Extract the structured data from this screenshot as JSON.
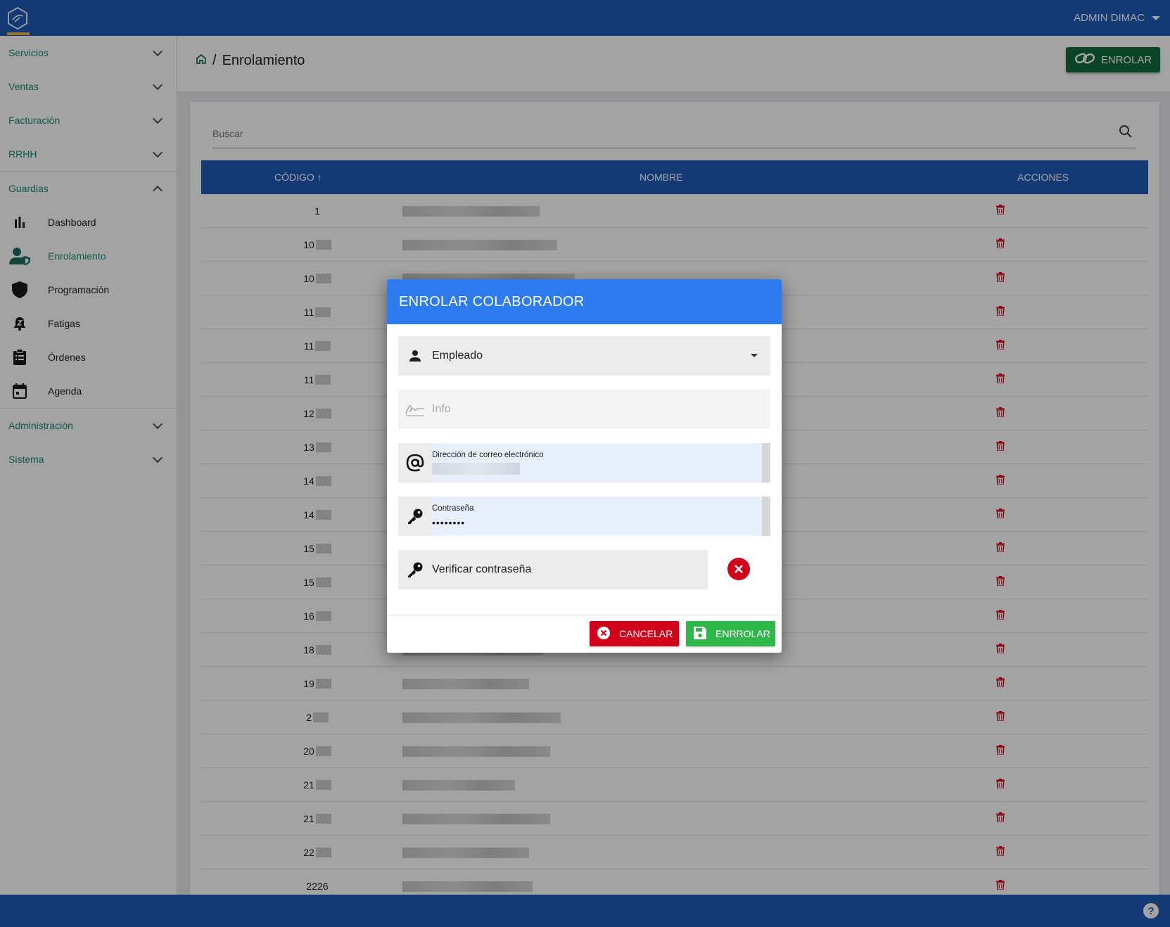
{
  "topbar": {
    "user_name": "ADMIN DIMAC"
  },
  "sidebar": {
    "sections": [
      {
        "label": "Servicios"
      },
      {
        "label": "Ventas"
      },
      {
        "label": "Facturación"
      },
      {
        "label": "RRHH"
      },
      {
        "label": "Guardias"
      }
    ],
    "guardias_items": [
      {
        "label": "Dashboard",
        "icon": "bar-chart-icon"
      },
      {
        "label": "Enrolamiento",
        "icon": "user-shield-icon"
      },
      {
        "label": "Programación",
        "icon": "shield-icon"
      },
      {
        "label": "Fatigas",
        "icon": "bell-z-icon"
      },
      {
        "label": "Órdenes",
        "icon": "clipboard-icon"
      },
      {
        "label": "Agenda",
        "icon": "calendar-icon"
      }
    ],
    "bottom_sections": [
      {
        "label": "Administración"
      },
      {
        "label": "Sistema"
      }
    ]
  },
  "header": {
    "breadcrumb_sep": "/",
    "title": "Enrolamiento",
    "enrolar_button": "ENROLAR"
  },
  "search": {
    "placeholder": "Buscar"
  },
  "table": {
    "columns": [
      "CÓDIGO",
      "NOMBRE",
      "ACCIONES"
    ],
    "sort_indicator": "↑",
    "rows": [
      {
        "code": "1"
      },
      {
        "code": "10"
      },
      {
        "code": "10"
      },
      {
        "code": "11"
      },
      {
        "code": "11"
      },
      {
        "code": "11"
      },
      {
        "code": "12"
      },
      {
        "code": "13"
      },
      {
        "code": "14"
      },
      {
        "code": "14"
      },
      {
        "code": "15"
      },
      {
        "code": "15"
      },
      {
        "code": "16"
      },
      {
        "code": "18"
      },
      {
        "code": "19"
      },
      {
        "code": "2"
      },
      {
        "code": "20"
      },
      {
        "code": "21"
      },
      {
        "code": "21"
      },
      {
        "code": "22"
      },
      {
        "code": "2226"
      }
    ]
  },
  "modal": {
    "title": "ENROLAR COLABORADOR",
    "employee_select": "Empleado",
    "info_placeholder": "Info",
    "email_label": "Dirección de correo electrónico",
    "password_label": "Contraseña",
    "password_value": "••••••••",
    "verify_placeholder": "Verificar contraseña",
    "cancel_button": "CANCELAR",
    "save_button": "ENRROLAR"
  },
  "colors": {
    "primary": "#1f5bb8",
    "modal_header": "#2e7bf0",
    "accent_teal": "#1a8a7a",
    "danger": "#d0021b",
    "success": "#2eb84a",
    "enrolar_green": "#0f6b3c"
  }
}
